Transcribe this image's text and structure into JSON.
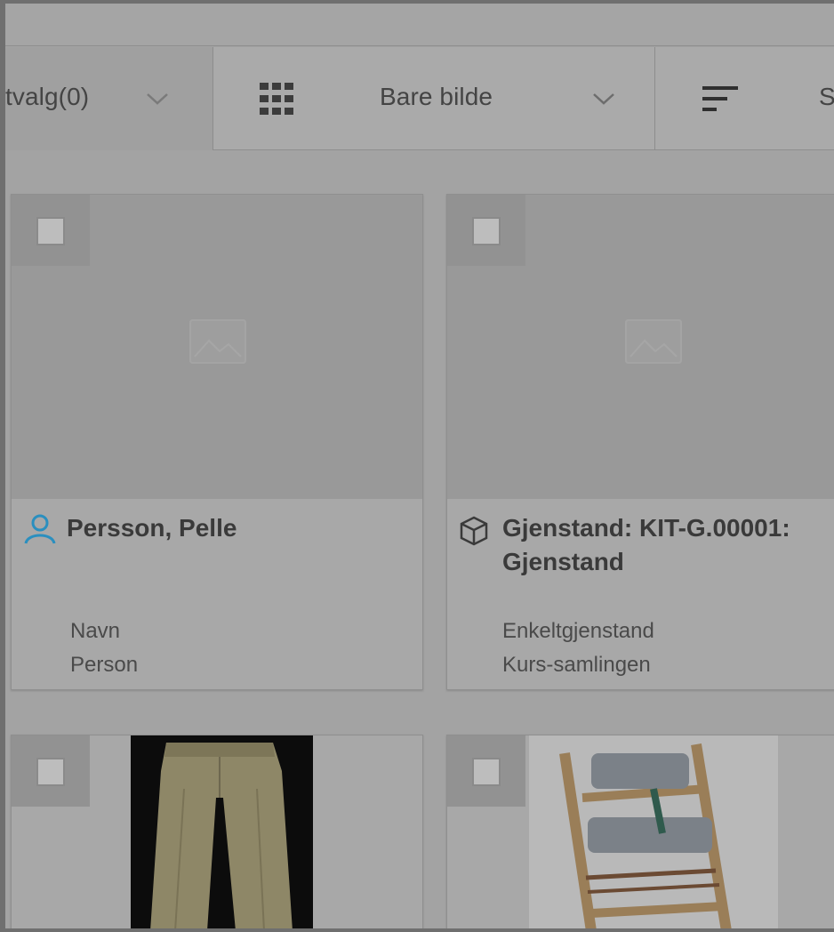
{
  "toolbar": {
    "selection_label": "tvalg(0)",
    "view_label": "Bare bilde",
    "sort_label": "S"
  },
  "cards": [
    {
      "title": "Persson, Pelle",
      "meta1": "Navn",
      "meta2": "Person",
      "icon": "person-icon"
    },
    {
      "title_line1": "Gjenstand: KIT-G.00001:",
      "title_line2": "Gjenstand",
      "meta1": "Enkeltgjenstand",
      "meta2": "Kurs-samlingen",
      "icon": "cube-icon"
    }
  ],
  "colors": {
    "person_icon": "#2a8fbf"
  }
}
